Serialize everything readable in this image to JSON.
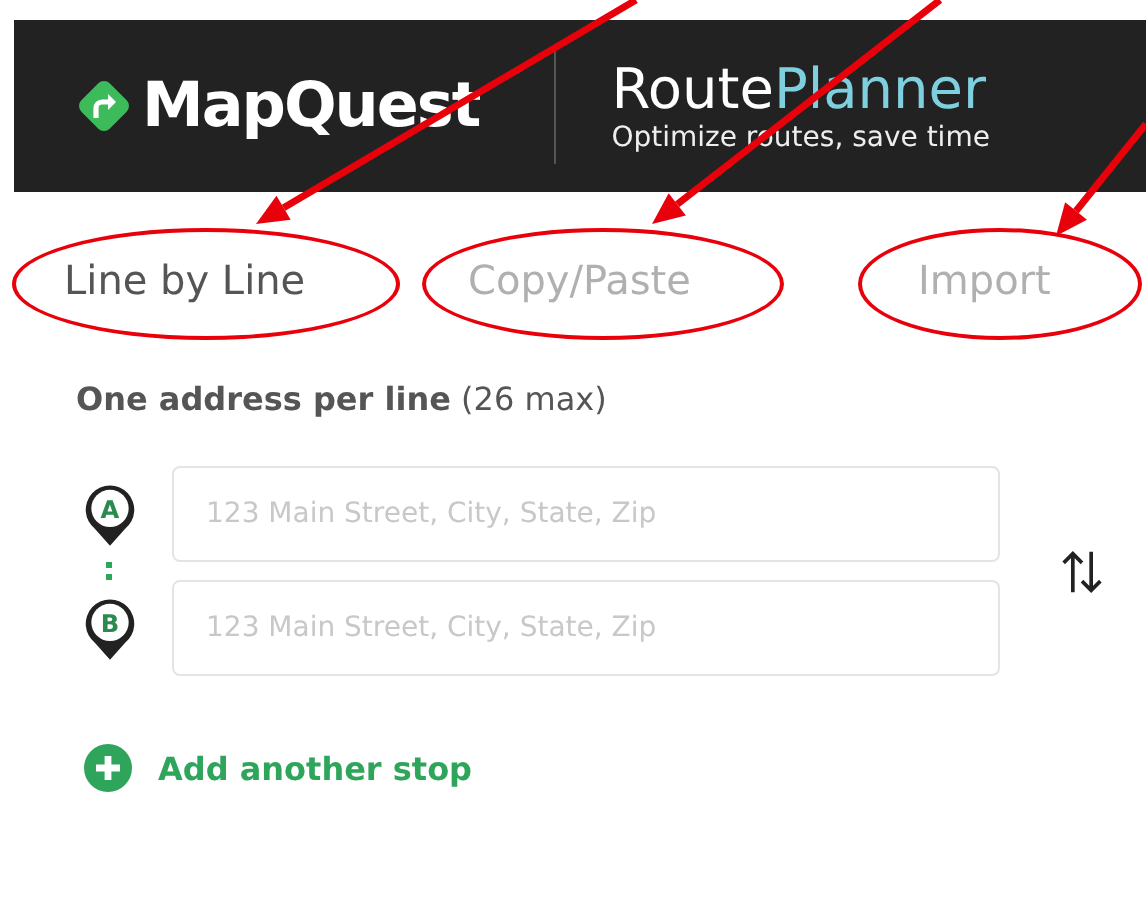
{
  "header": {
    "logo": "MapQuest",
    "product": "Route",
    "product_accent": "Planner",
    "tagline": "Optimize routes, save time"
  },
  "tabs": [
    {
      "label": "Line by Line",
      "selected": true,
      "circled": true
    },
    {
      "label": "Copy/Paste",
      "selected": false,
      "circled": true
    },
    {
      "label": "Import",
      "selected": false,
      "circled": true
    }
  ],
  "form": {
    "heading": "One address per line",
    "limit": "(26 max)",
    "stops": [
      {
        "pin": "A",
        "placeholder": "123 Main Street, City, State, Zip"
      },
      {
        "pin": "B",
        "placeholder": "123 Main Street, City, State, Zip"
      }
    ],
    "add_stop": "Add another stop"
  },
  "annotation_arrows": [
    {
      "kind": "arrow"
    },
    {
      "kind": "arrow"
    },
    {
      "kind": "arrow"
    }
  ]
}
